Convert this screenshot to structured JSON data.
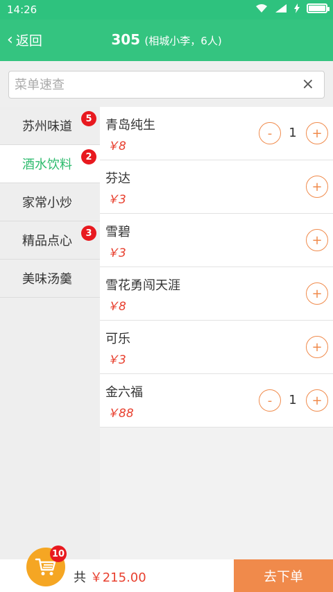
{
  "status": {
    "time": "14:26"
  },
  "header": {
    "back_label": "返回",
    "table_number": "305",
    "table_info": "(相城小李，6人)"
  },
  "search": {
    "placeholder": "菜单速查"
  },
  "categories": [
    {
      "label": "苏州味道",
      "badge": "5"
    },
    {
      "label": "酒水饮料",
      "badge": "2",
      "active": true
    },
    {
      "label": "家常小炒",
      "badge": ""
    },
    {
      "label": "精品点心",
      "badge": "3"
    },
    {
      "label": "美味汤羹",
      "badge": ""
    }
  ],
  "items": [
    {
      "name": "青岛纯生",
      "price": "￥8",
      "qty": "1"
    },
    {
      "name": "芬达",
      "price": "￥3",
      "qty": ""
    },
    {
      "name": "雪碧",
      "price": "￥3",
      "qty": ""
    },
    {
      "name": "雪花勇闯天涯",
      "price": "￥8",
      "qty": ""
    },
    {
      "name": "可乐",
      "price": "￥3",
      "qty": ""
    },
    {
      "name": "金六福",
      "price": "￥88",
      "qty": "1"
    }
  ],
  "buttons": {
    "minus": "-",
    "plus": "+"
  },
  "cart": {
    "count": "10",
    "total_prefix": "共",
    "total_amount": "￥215.00"
  },
  "order_button": "去下单",
  "colors": {
    "primary": "#34c480",
    "accent": "#f08a4b",
    "price": "#e8402f",
    "badge": "#e8191f",
    "cart": "#f5a623"
  },
  "battery_level": 1.0
}
